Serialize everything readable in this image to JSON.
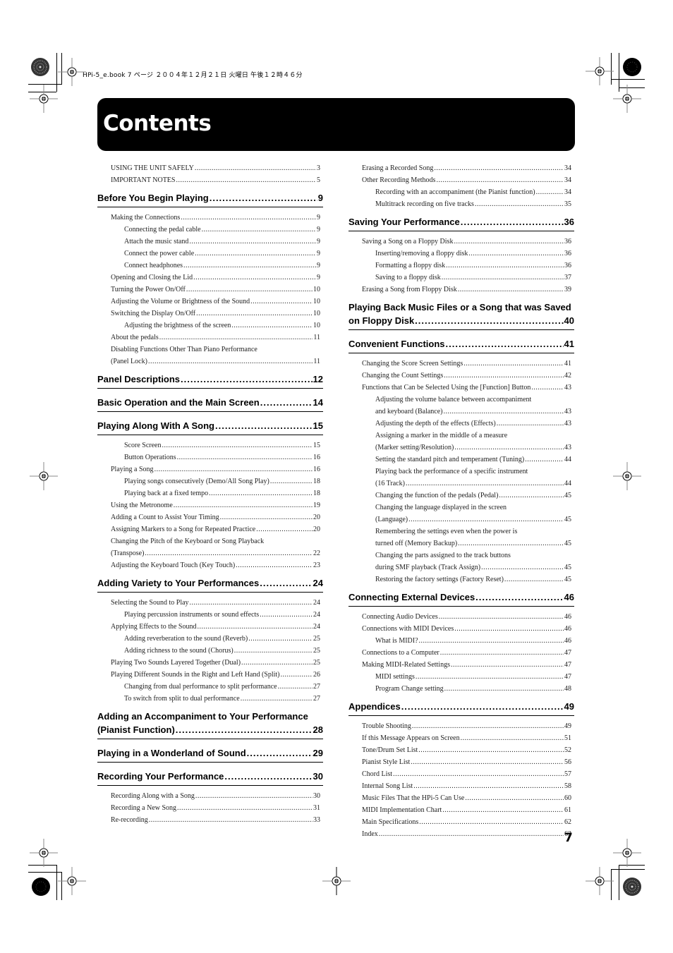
{
  "header_meta": "HPi-5_e.book 7 ページ ２００４年１２月２１日 火曜日 午後１２時４６分",
  "title": "Contents",
  "page_number": "7",
  "left_column": [
    {
      "type": "entry",
      "level": 1,
      "label": "USING THE UNIT SAFELY",
      "page": "3"
    },
    {
      "type": "entry",
      "level": 1,
      "label": "IMPORTANT NOTES",
      "page": "5"
    },
    {
      "type": "section",
      "label": "Before You Begin Playing",
      "page": "9"
    },
    {
      "type": "entry",
      "level": 1,
      "label": "Making the Connections",
      "page": "9"
    },
    {
      "type": "entry",
      "level": 2,
      "label": "Connecting the pedal cable",
      "page": "9"
    },
    {
      "type": "entry",
      "level": 2,
      "label": "Attach the music stand",
      "page": "9"
    },
    {
      "type": "entry",
      "level": 2,
      "label": "Connect the power cable",
      "page": "9"
    },
    {
      "type": "entry",
      "level": 2,
      "label": "Connect headphones",
      "page": "9"
    },
    {
      "type": "entry",
      "level": 1,
      "label": "Opening and Closing the Lid",
      "page": "9"
    },
    {
      "type": "entry",
      "level": 1,
      "label": "Turning the Power On/Off",
      "page": "10"
    },
    {
      "type": "entry",
      "level": 1,
      "label": "Adjusting the Volume or Brightness of the Sound",
      "page": "10"
    },
    {
      "type": "entry",
      "level": 1,
      "label": "Switching the Display On/Off",
      "page": "10"
    },
    {
      "type": "entry",
      "level": 2,
      "label": "Adjusting the brightness of the screen",
      "page": "10"
    },
    {
      "type": "entry",
      "level": 1,
      "label": "About the pedals",
      "page": "11"
    },
    {
      "type": "entry",
      "level": 1,
      "label": "Disabling Functions Other Than Piano Performance",
      "label2": "(Panel Lock)",
      "page": "11"
    },
    {
      "type": "section",
      "label": "Panel Descriptions",
      "page": "12"
    },
    {
      "type": "section",
      "label": "Basic Operation and the Main Screen",
      "page": "14"
    },
    {
      "type": "section",
      "label": "Playing Along With A Song",
      "page": "15"
    },
    {
      "type": "entry",
      "level": 2,
      "label": "Score Screen",
      "page": "15"
    },
    {
      "type": "entry",
      "level": 2,
      "label": "Button Operations",
      "page": "16"
    },
    {
      "type": "entry",
      "level": 1,
      "label": "Playing a Song",
      "page": "16"
    },
    {
      "type": "entry",
      "level": 2,
      "label": "Playing songs consecutively (Demo/All Song Play)",
      "page": "18"
    },
    {
      "type": "entry",
      "level": 2,
      "label": "Playing back at a fixed tempo",
      "page": "18"
    },
    {
      "type": "entry",
      "level": 1,
      "label": "Using the Metronome",
      "page": "19"
    },
    {
      "type": "entry",
      "level": 1,
      "label": "Adding a Count to Assist Your Timing",
      "page": "20"
    },
    {
      "type": "entry",
      "level": 1,
      "label": "Assigning Markers to a Song for Repeated Practice",
      "page": "20"
    },
    {
      "type": "entry",
      "level": 1,
      "label": "Changing the Pitch of the Keyboard or Song Playback",
      "label2": "(Transpose)",
      "page": "22"
    },
    {
      "type": "entry",
      "level": 1,
      "label": "Adjusting the Keyboard Touch (Key Touch)",
      "page": "23"
    },
    {
      "type": "section",
      "label": "Adding Variety to Your Performances",
      "page": "24"
    },
    {
      "type": "entry",
      "level": 1,
      "label": "Selecting the Sound to Play",
      "page": "24"
    },
    {
      "type": "entry",
      "level": 2,
      "label": "Playing percussion instruments or sound effects",
      "page": "24"
    },
    {
      "type": "entry",
      "level": 1,
      "label": "Applying Effects to the Sound",
      "page": "24"
    },
    {
      "type": "entry",
      "level": 2,
      "label": "Adding reverberation to the sound (Reverb)",
      "page": "25"
    },
    {
      "type": "entry",
      "level": 2,
      "label": "Adding richness to the sound (Chorus)",
      "page": "25"
    },
    {
      "type": "entry",
      "level": 1,
      "label": "Playing Two Sounds Layered Together (Dual)",
      "page": "25"
    },
    {
      "type": "entry",
      "level": 1,
      "label": "Playing Different Sounds in the Right and Left Hand (Split)",
      "page": "26"
    },
    {
      "type": "entry",
      "level": 2,
      "label": "Changing from dual performance to split performance",
      "page": "27"
    },
    {
      "type": "entry",
      "level": 2,
      "label": "To switch from split to dual performance",
      "page": "27"
    },
    {
      "type": "section",
      "label": "Adding an Accompaniment to Your Performance",
      "label2": "(Pianist Function)",
      "page": "28"
    },
    {
      "type": "section",
      "label": "Playing in a Wonderland of Sound",
      "page": "29"
    },
    {
      "type": "section",
      "label": "Recording Your Performance",
      "page": "30"
    },
    {
      "type": "entry",
      "level": 1,
      "label": "Recording Along with a Song",
      "page": "30"
    },
    {
      "type": "entry",
      "level": 1,
      "label": "Recording a New Song",
      "page": "31"
    },
    {
      "type": "entry",
      "level": 1,
      "label": "Re-recording",
      "page": "33"
    }
  ],
  "right_column": [
    {
      "type": "entry",
      "level": 1,
      "label": "Erasing a Recorded Song",
      "page": "34"
    },
    {
      "type": "entry",
      "level": 1,
      "label": "Other Recording Methods",
      "page": "34"
    },
    {
      "type": "entry",
      "level": 2,
      "label": "Recording with an accompaniment (the Pianist function)",
      "page": "34"
    },
    {
      "type": "entry",
      "level": 2,
      "label": "Multitrack recording on five tracks",
      "page": "35"
    },
    {
      "type": "section",
      "label": "Saving Your Performance",
      "page": "36"
    },
    {
      "type": "entry",
      "level": 1,
      "label": "Saving a Song on a Floppy Disk",
      "page": "36"
    },
    {
      "type": "entry",
      "level": 2,
      "label": "Inserting/removing a floppy disk",
      "page": "36"
    },
    {
      "type": "entry",
      "level": 2,
      "label": "Formatting a floppy disk",
      "page": "36"
    },
    {
      "type": "entry",
      "level": 2,
      "label": "Saving to a floppy disk",
      "page": "37"
    },
    {
      "type": "entry",
      "level": 1,
      "label": "Erasing a Song from Floppy Disk",
      "page": "39"
    },
    {
      "type": "section",
      "label": "Playing Back Music Files or a Song that was Saved",
      "label2": "on Floppy Disk",
      "page": "40"
    },
    {
      "type": "section",
      "label": "Convenient Functions",
      "page": "41"
    },
    {
      "type": "entry",
      "level": 1,
      "label": "Changing the Score Screen Settings",
      "page": "41"
    },
    {
      "type": "entry",
      "level": 1,
      "label": "Changing the Count Settings",
      "page": "42"
    },
    {
      "type": "entry",
      "level": 1,
      "label": "Functions that Can be Selected Using the [Function] Button",
      "page": "43"
    },
    {
      "type": "entry",
      "level": 2,
      "label": "Adjusting the volume balance between accompaniment",
      "label2": "and keyboard (Balance)",
      "page": "43"
    },
    {
      "type": "entry",
      "level": 2,
      "label": "Adjusting the depth of the effects (Effects)",
      "page": "43"
    },
    {
      "type": "entry",
      "level": 2,
      "label": "Assigning a marker in the middle of a measure",
      "label2": "(Marker setting/Resolution)",
      "page": "43"
    },
    {
      "type": "entry",
      "level": 2,
      "label": "Setting the standard pitch and temperament (Tuning)",
      "page": "44"
    },
    {
      "type": "entry",
      "level": 2,
      "label": "Playing back the performance of a specific instrument",
      "label2": "(16 Track)",
      "page": "44"
    },
    {
      "type": "entry",
      "level": 2,
      "label": "Changing the function of the pedals (Pedal)",
      "page": "45"
    },
    {
      "type": "entry",
      "level": 2,
      "label": "Changing the language displayed in the screen",
      "label2": "(Language)",
      "page": "45"
    },
    {
      "type": "entry",
      "level": 2,
      "label": "Remembering the settings even when the power is",
      "label2": "turned off (Memory Backup)",
      "page": "45"
    },
    {
      "type": "entry",
      "level": 2,
      "label": "Changing the parts assigned to the track buttons",
      "label2": "during SMF playback (Track Assign)",
      "page": "45"
    },
    {
      "type": "entry",
      "level": 2,
      "label": "Restoring the factory settings (Factory Reset)",
      "page": "45"
    },
    {
      "type": "section",
      "label": "Connecting External Devices",
      "page": "46"
    },
    {
      "type": "entry",
      "level": 1,
      "label": "Connecting Audio Devices",
      "page": "46"
    },
    {
      "type": "entry",
      "level": 1,
      "label": "Connections with MIDI Devices",
      "page": "46"
    },
    {
      "type": "entry",
      "level": 2,
      "label": "What is MIDI?",
      "page": "46"
    },
    {
      "type": "entry",
      "level": 1,
      "label": "Connections to a Computer",
      "page": "47"
    },
    {
      "type": "entry",
      "level": 1,
      "label": "Making MIDI-Related Settings",
      "page": "47"
    },
    {
      "type": "entry",
      "level": 2,
      "label": "MIDI settings",
      "page": "47"
    },
    {
      "type": "entry",
      "level": 2,
      "label": "Program Change setting",
      "page": "48"
    },
    {
      "type": "section",
      "label": "Appendices",
      "page": "49"
    },
    {
      "type": "entry",
      "level": 1,
      "label": "Trouble Shooting",
      "page": "49"
    },
    {
      "type": "entry",
      "level": 1,
      "label": "If this Message Appears on Screen",
      "page": "51"
    },
    {
      "type": "entry",
      "level": 1,
      "label": "Tone/Drum Set List",
      "page": "52"
    },
    {
      "type": "entry",
      "level": 1,
      "label": "Pianist Style List",
      "page": "56"
    },
    {
      "type": "entry",
      "level": 1,
      "label": "Chord List",
      "page": "57"
    },
    {
      "type": "entry",
      "level": 1,
      "label": "Internal Song List",
      "page": "58"
    },
    {
      "type": "entry",
      "level": 1,
      "label": "Music Files That the HPi-5 Can Use",
      "page": "60"
    },
    {
      "type": "entry",
      "level": 1,
      "label": "MIDI Implementation Chart",
      "page": "61"
    },
    {
      "type": "entry",
      "level": 1,
      "label": "Main Specifications",
      "page": "62"
    },
    {
      "type": "entry",
      "level": 1,
      "label": "Index",
      "page": "63"
    }
  ]
}
